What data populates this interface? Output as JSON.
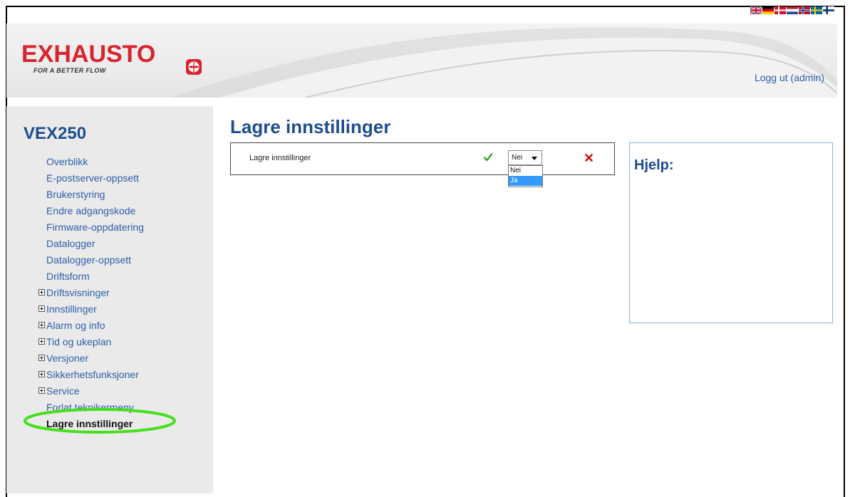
{
  "header": {
    "brand": "EXHAUSTO",
    "tagline": "FOR A BETTER FLOW",
    "logout": "Logg ut (admin)",
    "languages": [
      "gb-flag-icon",
      "de-flag-icon",
      "dk-flag-icon",
      "nl-flag-icon",
      "no-flag-icon",
      "se-flag-icon",
      "fi-flag-icon"
    ]
  },
  "sidebar": {
    "device": "VEX250",
    "items": [
      {
        "label": "Overblikk",
        "expandable": false
      },
      {
        "label": "E-postserver-oppsett",
        "expandable": false
      },
      {
        "label": "Brukerstyring",
        "expandable": false
      },
      {
        "label": "Endre adgangskode",
        "expandable": false
      },
      {
        "label": "Firmware-oppdatering",
        "expandable": false
      },
      {
        "label": "Datalogger",
        "expandable": false
      },
      {
        "label": "Datalogger-oppsett",
        "expandable": false
      },
      {
        "label": "Driftsform",
        "expandable": false
      },
      {
        "label": "Driftsvisninger",
        "expandable": true
      },
      {
        "label": "Innstillinger",
        "expandable": true
      },
      {
        "label": "Alarm og info",
        "expandable": true
      },
      {
        "label": "Tid og ukeplan",
        "expandable": true
      },
      {
        "label": "Versjoner",
        "expandable": true
      },
      {
        "label": "Sikkerhetsfunksjoner",
        "expandable": true
      },
      {
        "label": "Service",
        "expandable": true
      },
      {
        "label": "Forlat teknikermeny",
        "expandable": false
      },
      {
        "label": "Lagre innstillinger",
        "expandable": false,
        "active": true
      }
    ]
  },
  "main": {
    "title": "Lagre innstillinger",
    "setting": {
      "label": "Lagre innstillinger",
      "selected": "Nei",
      "options": [
        "Nei",
        "Ja"
      ],
      "highlighted_option": "Ja"
    }
  },
  "help": {
    "title": "Hjelp:"
  },
  "colors": {
    "brand_red": "#d9232d",
    "title_blue": "#1e4d8f",
    "link_blue": "#2d5ea8",
    "highlight_green": "#44e01a",
    "check_green": "#3aa02a",
    "close_red": "#cc1111"
  }
}
